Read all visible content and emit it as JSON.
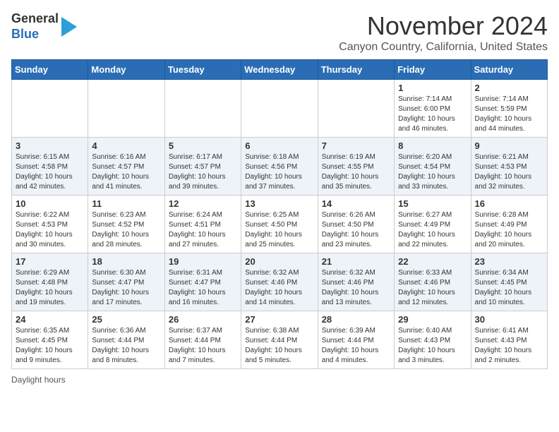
{
  "logo": {
    "general": "General",
    "blue": "Blue"
  },
  "title": "November 2024",
  "subtitle": "Canyon Country, California, United States",
  "days_of_week": [
    "Sunday",
    "Monday",
    "Tuesday",
    "Wednesday",
    "Thursday",
    "Friday",
    "Saturday"
  ],
  "footer": "Daylight hours",
  "weeks": [
    [
      {
        "day": "",
        "info": ""
      },
      {
        "day": "",
        "info": ""
      },
      {
        "day": "",
        "info": ""
      },
      {
        "day": "",
        "info": ""
      },
      {
        "day": "",
        "info": ""
      },
      {
        "day": "1",
        "info": "Sunrise: 7:14 AM\nSunset: 6:00 PM\nDaylight: 10 hours and 46 minutes."
      },
      {
        "day": "2",
        "info": "Sunrise: 7:14 AM\nSunset: 5:59 PM\nDaylight: 10 hours and 44 minutes."
      }
    ],
    [
      {
        "day": "3",
        "info": "Sunrise: 6:15 AM\nSunset: 4:58 PM\nDaylight: 10 hours and 42 minutes."
      },
      {
        "day": "4",
        "info": "Sunrise: 6:16 AM\nSunset: 4:57 PM\nDaylight: 10 hours and 41 minutes."
      },
      {
        "day": "5",
        "info": "Sunrise: 6:17 AM\nSunset: 4:57 PM\nDaylight: 10 hours and 39 minutes."
      },
      {
        "day": "6",
        "info": "Sunrise: 6:18 AM\nSunset: 4:56 PM\nDaylight: 10 hours and 37 minutes."
      },
      {
        "day": "7",
        "info": "Sunrise: 6:19 AM\nSunset: 4:55 PM\nDaylight: 10 hours and 35 minutes."
      },
      {
        "day": "8",
        "info": "Sunrise: 6:20 AM\nSunset: 4:54 PM\nDaylight: 10 hours and 33 minutes."
      },
      {
        "day": "9",
        "info": "Sunrise: 6:21 AM\nSunset: 4:53 PM\nDaylight: 10 hours and 32 minutes."
      }
    ],
    [
      {
        "day": "10",
        "info": "Sunrise: 6:22 AM\nSunset: 4:53 PM\nDaylight: 10 hours and 30 minutes."
      },
      {
        "day": "11",
        "info": "Sunrise: 6:23 AM\nSunset: 4:52 PM\nDaylight: 10 hours and 28 minutes."
      },
      {
        "day": "12",
        "info": "Sunrise: 6:24 AM\nSunset: 4:51 PM\nDaylight: 10 hours and 27 minutes."
      },
      {
        "day": "13",
        "info": "Sunrise: 6:25 AM\nSunset: 4:50 PM\nDaylight: 10 hours and 25 minutes."
      },
      {
        "day": "14",
        "info": "Sunrise: 6:26 AM\nSunset: 4:50 PM\nDaylight: 10 hours and 23 minutes."
      },
      {
        "day": "15",
        "info": "Sunrise: 6:27 AM\nSunset: 4:49 PM\nDaylight: 10 hours and 22 minutes."
      },
      {
        "day": "16",
        "info": "Sunrise: 6:28 AM\nSunset: 4:49 PM\nDaylight: 10 hours and 20 minutes."
      }
    ],
    [
      {
        "day": "17",
        "info": "Sunrise: 6:29 AM\nSunset: 4:48 PM\nDaylight: 10 hours and 19 minutes."
      },
      {
        "day": "18",
        "info": "Sunrise: 6:30 AM\nSunset: 4:47 PM\nDaylight: 10 hours and 17 minutes."
      },
      {
        "day": "19",
        "info": "Sunrise: 6:31 AM\nSunset: 4:47 PM\nDaylight: 10 hours and 16 minutes."
      },
      {
        "day": "20",
        "info": "Sunrise: 6:32 AM\nSunset: 4:46 PM\nDaylight: 10 hours and 14 minutes."
      },
      {
        "day": "21",
        "info": "Sunrise: 6:32 AM\nSunset: 4:46 PM\nDaylight: 10 hours and 13 minutes."
      },
      {
        "day": "22",
        "info": "Sunrise: 6:33 AM\nSunset: 4:46 PM\nDaylight: 10 hours and 12 minutes."
      },
      {
        "day": "23",
        "info": "Sunrise: 6:34 AM\nSunset: 4:45 PM\nDaylight: 10 hours and 10 minutes."
      }
    ],
    [
      {
        "day": "24",
        "info": "Sunrise: 6:35 AM\nSunset: 4:45 PM\nDaylight: 10 hours and 9 minutes."
      },
      {
        "day": "25",
        "info": "Sunrise: 6:36 AM\nSunset: 4:44 PM\nDaylight: 10 hours and 8 minutes."
      },
      {
        "day": "26",
        "info": "Sunrise: 6:37 AM\nSunset: 4:44 PM\nDaylight: 10 hours and 7 minutes."
      },
      {
        "day": "27",
        "info": "Sunrise: 6:38 AM\nSunset: 4:44 PM\nDaylight: 10 hours and 5 minutes."
      },
      {
        "day": "28",
        "info": "Sunrise: 6:39 AM\nSunset: 4:44 PM\nDaylight: 10 hours and 4 minutes."
      },
      {
        "day": "29",
        "info": "Sunrise: 6:40 AM\nSunset: 4:43 PM\nDaylight: 10 hours and 3 minutes."
      },
      {
        "day": "30",
        "info": "Sunrise: 6:41 AM\nSunset: 4:43 PM\nDaylight: 10 hours and 2 minutes."
      }
    ]
  ]
}
